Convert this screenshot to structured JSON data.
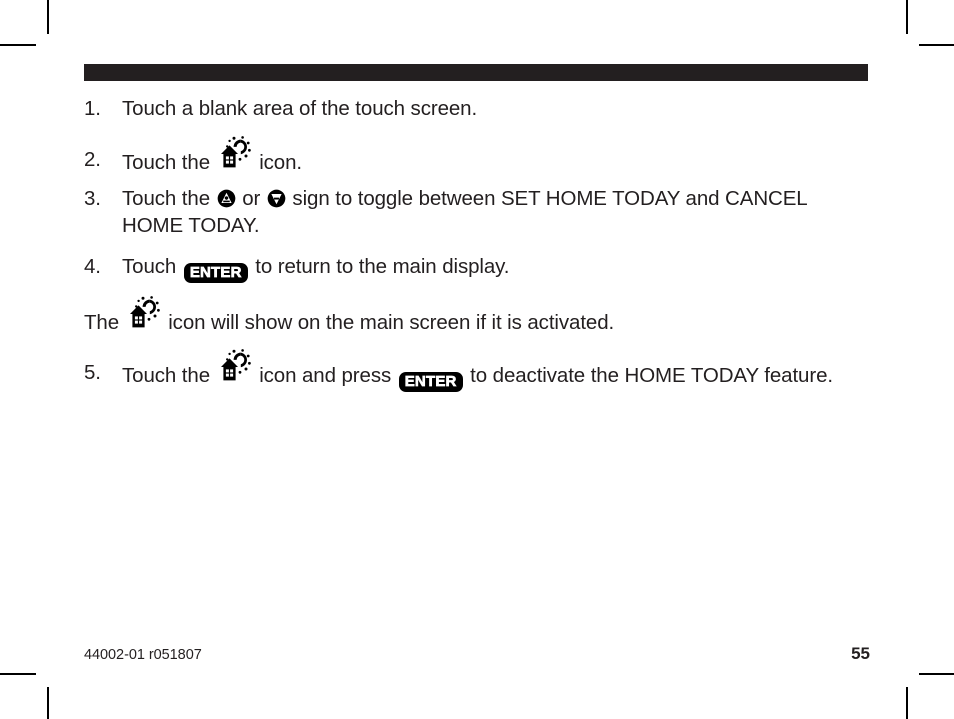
{
  "page": {
    "header_bar_color": "#231f20",
    "text_color": "#231f20",
    "background_color": "#ffffff"
  },
  "icons": {
    "home_sun": "home-with-sun-icon",
    "arrow_up": "arrow-up-key-icon",
    "arrow_down": "arrow-down-key-icon",
    "enter_key": "enter-key-icon"
  },
  "steps": [
    {
      "number": "1.",
      "segments": [
        {
          "type": "text",
          "value": "Touch a blank area of the touch screen."
        }
      ]
    },
    {
      "number": "2.",
      "segments": [
        {
          "type": "text",
          "value": "Touch the "
        },
        {
          "type": "icon",
          "value": "home-with-sun-icon"
        },
        {
          "type": "text",
          "value": " icon."
        }
      ]
    },
    {
      "number": "3.",
      "segments": [
        {
          "type": "text",
          "value": "Touch the "
        },
        {
          "type": "icon",
          "value": "arrow-up-key-icon"
        },
        {
          "type": "text",
          "value": " or "
        },
        {
          "type": "icon",
          "value": "arrow-down-key-icon"
        },
        {
          "type": "text",
          "value": " sign to toggle between SET HOME TODAY and CANCEL HOME TODAY."
        }
      ]
    },
    {
      "number": "4.",
      "segments": [
        {
          "type": "text",
          "value": "Touch "
        },
        {
          "type": "key",
          "value": "ENTER"
        },
        {
          "type": "text",
          "value": " to return to the main display."
        }
      ]
    },
    {
      "number": "5.",
      "segments": [
        {
          "type": "text",
          "value": "Touch the "
        },
        {
          "type": "icon",
          "value": "home-with-sun-icon"
        },
        {
          "type": "text",
          "value": " icon and press "
        },
        {
          "type": "key",
          "value": "ENTER"
        },
        {
          "type": "text",
          "value": " to deactivate the HOME TODAY feature."
        }
      ]
    }
  ],
  "note": {
    "lead": "The ",
    "icon": "home-with-sun-icon",
    "trail": " icon will show on the main screen if it is activated."
  },
  "text": {
    "step1_line": "Touch a blank area of the touch screen.",
    "step2_pre": "Touch the ",
    "step2_post": " icon.",
    "step3_pre": "Touch the ",
    "step3_mid": " or ",
    "step3_post": " sign to toggle between SET HOME TODAY and CANCEL HOME TODAY.",
    "step4_pre": "Touch ",
    "step4_post": " to return to the main display.",
    "note_pre": "The ",
    "note_post": " icon will show on the main screen if it is activated.",
    "step5_pre": "Touch the ",
    "step5_mid": " icon and press ",
    "step5_post": " to deactivate the HOME TODAY feature.",
    "enter_label": "ENTER",
    "num1": "1.",
    "num2": "2.",
    "num3": "3.",
    "num4": "4.",
    "num5": "5."
  },
  "footer": {
    "document_code": "44002-01 r051807",
    "page_number": "55"
  }
}
